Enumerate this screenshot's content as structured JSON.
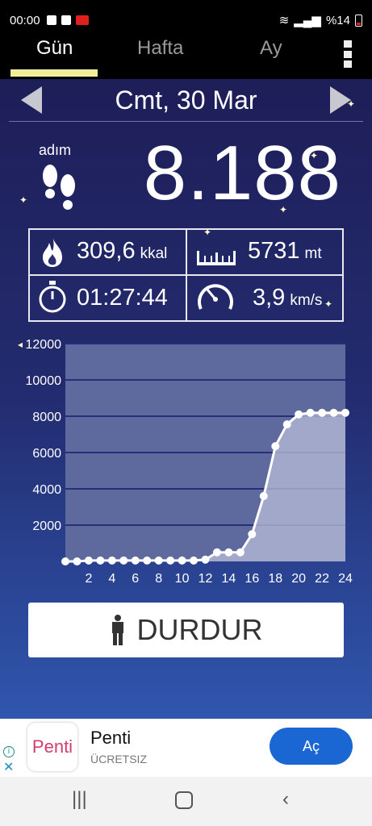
{
  "status_bar": {
    "time": "00:00",
    "battery": "%14"
  },
  "tabs": [
    {
      "label": "Gün",
      "active": true
    },
    {
      "label": "Hafta",
      "active": false
    },
    {
      "label": "Ay",
      "active": false
    }
  ],
  "date": {
    "label": "Cmt, 30 Mar"
  },
  "steps": {
    "unit": "adım",
    "value": "8.188"
  },
  "stats": {
    "calories": {
      "value": "309,6",
      "unit": "kkal"
    },
    "distance": {
      "value": "5731",
      "unit": "mt"
    },
    "duration": {
      "value": "01:27:44"
    },
    "speed": {
      "value": "3,9",
      "unit": "km/s"
    }
  },
  "chart_data": {
    "type": "area",
    "x": [
      0,
      1,
      2,
      3,
      4,
      5,
      6,
      7,
      8,
      9,
      10,
      11,
      12,
      13,
      14,
      15,
      16,
      17,
      18,
      19,
      20,
      21,
      22,
      23,
      24
    ],
    "values": [
      0,
      0,
      50,
      50,
      50,
      50,
      50,
      50,
      50,
      50,
      50,
      50,
      100,
      500,
      500,
      500,
      1500,
      3600,
      6350,
      7550,
      8100,
      8188,
      8188,
      8188,
      8188
    ],
    "xticks": [
      "2",
      "4",
      "6",
      "8",
      "10",
      "12",
      "14",
      "16",
      "18",
      "20",
      "22",
      "24"
    ],
    "yticks": [
      "2000",
      "4000",
      "6000",
      "8000",
      "10000",
      "12000"
    ],
    "ylim": [
      0,
      12000
    ],
    "xlim": [
      0,
      24
    ],
    "colors": {
      "fill": "#b9bdd9",
      "line": "#ffffff",
      "plot_bg": "#5e6a9d"
    }
  },
  "actions": {
    "stop_label": "DURDUR"
  },
  "ad": {
    "logo_text": "Penti",
    "title": "Penti",
    "subtitle": "ÜCRETSIZ",
    "cta_label": "Aç"
  },
  "colors": {
    "tab_underline": "#f3ee9a",
    "ad_button": "#1a66d2"
  }
}
